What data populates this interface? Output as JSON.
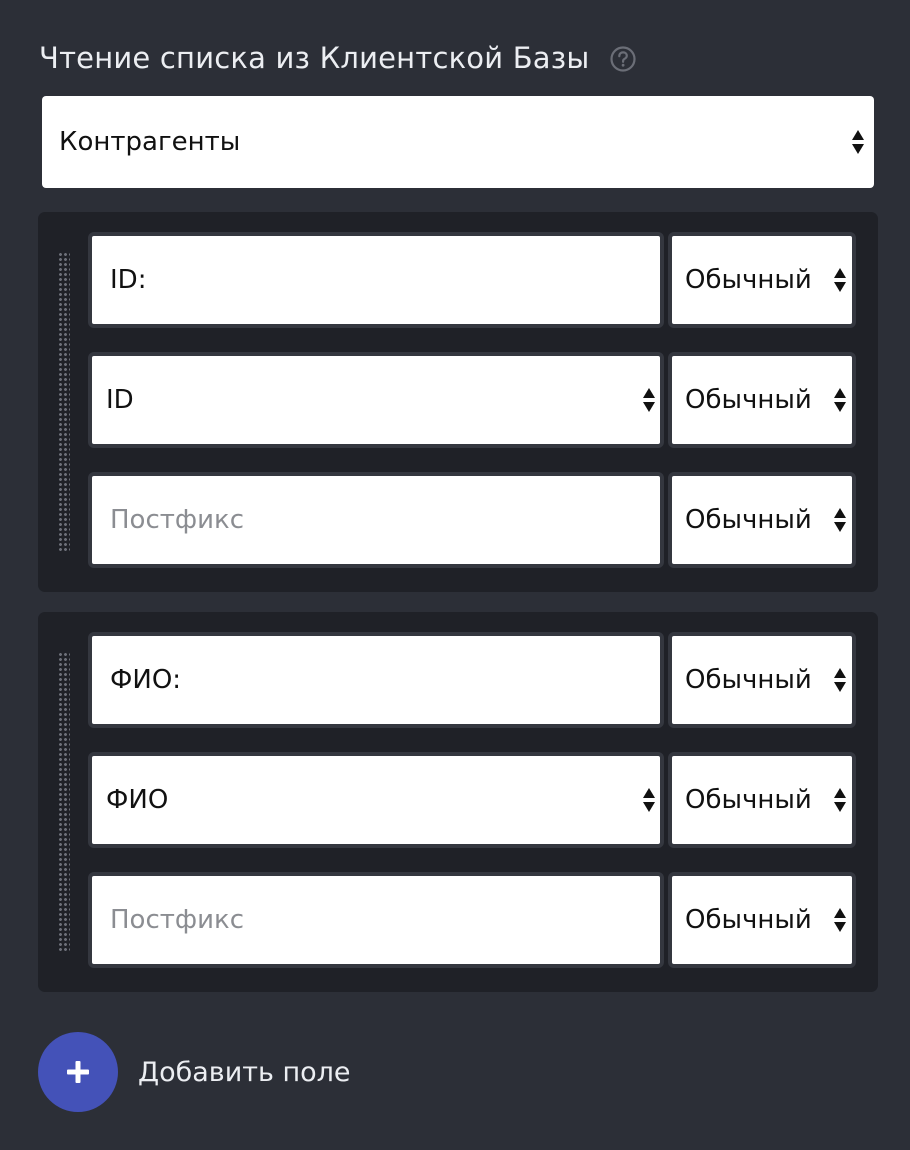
{
  "header": {
    "title": "Чтение списка из Клиентской Базы",
    "help_icon": "question-circle-icon"
  },
  "source_select": {
    "value": "Контрагенты"
  },
  "groups": [
    {
      "label_field": {
        "value": "ID:"
      },
      "label_mode": "Обычный",
      "field_select": {
        "value": "ID"
      },
      "field_mode": "Обычный",
      "postfix_field": {
        "value": "",
        "placeholder": "Постфикс"
      },
      "postfix_mode": "Обычный"
    },
    {
      "label_field": {
        "value": "ФИО:"
      },
      "label_mode": "Обычный",
      "field_select": {
        "value": "ФИО"
      },
      "field_mode": "Обычный",
      "postfix_field": {
        "value": "",
        "placeholder": "Постфикс"
      },
      "postfix_mode": "Обычный"
    }
  ],
  "add_field": {
    "label": "Добавить поле",
    "icon": "plus-icon"
  },
  "colors": {
    "background": "#2c2f37",
    "panel": "#1f2127",
    "accent": "#4452b8"
  }
}
